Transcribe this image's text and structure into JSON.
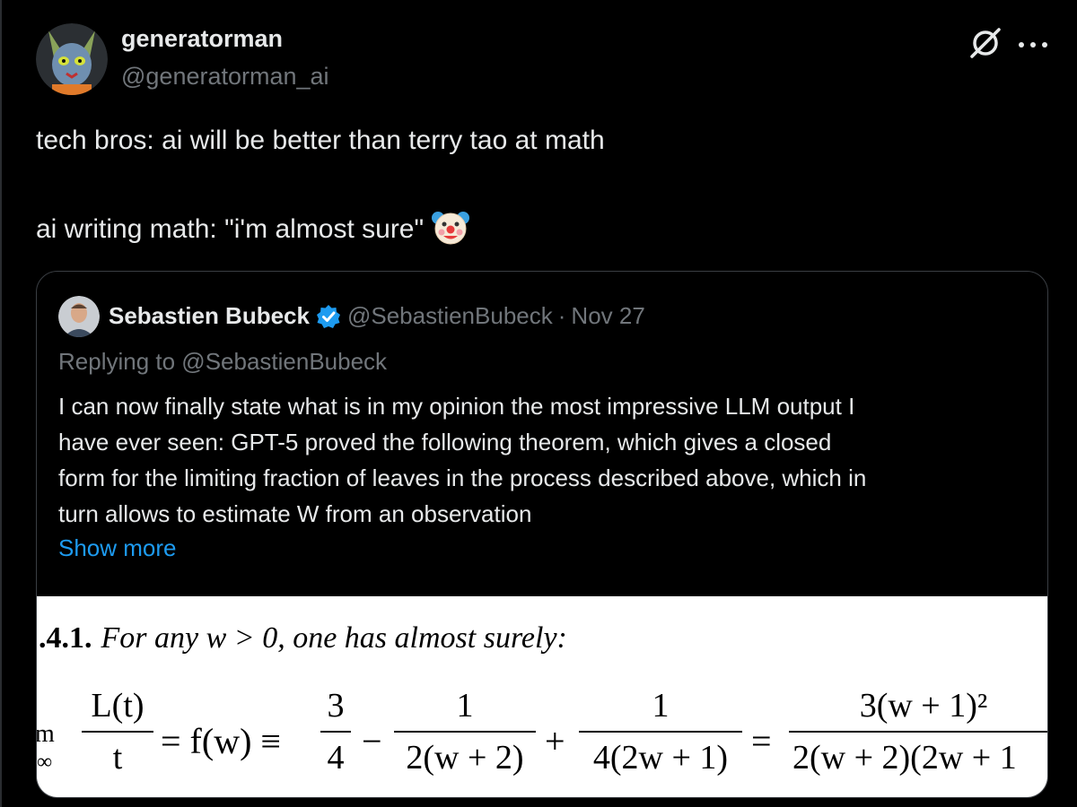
{
  "tweet": {
    "display_name": "generatorman",
    "handle": "@generatorman_ai",
    "text_line1": "tech bros: ai will be better than terry tao at math",
    "text_line2": "ai writing math: \"i'm almost sure\"",
    "emoji": "clown-face",
    "icons": [
      "grok-icon",
      "more-icon"
    ]
  },
  "quote": {
    "name": "Sebastien Bubeck",
    "handle": "@SebastienBubeck",
    "separator": "·",
    "date": "Nov 27",
    "replying_to": "Replying to @SebastienBubeck",
    "body_lines": [
      "I can now finally state what is in my opinion the most impressive LLM output I",
      "have ever seen: GPT-5 proved the following theorem, which gives a closed",
      "form for the limiting fraction of leaves in the process described above, which in",
      "turn allows to estimate W from an observation"
    ],
    "show_more": "Show more",
    "math": {
      "theorem_number": ".4.1.",
      "theorem_text": "For any w > 0, one has almost surely:",
      "lim_top": "m",
      "lim_bottom": "·∞",
      "frac1_num": "L(t)",
      "frac1_den": "t",
      "eq_fw": "= f(w) ≡",
      "frac2_num": "3",
      "frac2_den": "4",
      "minus": "−",
      "frac3_num": "1",
      "frac3_den": "2(w + 2)",
      "plus": "+",
      "frac4_num": "1",
      "frac4_den": "4(2w + 1)",
      "equals": "=",
      "frac5_num": "3(w + 1)²",
      "frac5_den": "2(w + 2)(2w + 1"
    }
  },
  "colors": {
    "background": "#000000",
    "text": "#e7e9ea",
    "muted": "#71767b",
    "link": "#1d9bf0",
    "border": "#3a3e43",
    "verified": "#1d9bf0"
  }
}
